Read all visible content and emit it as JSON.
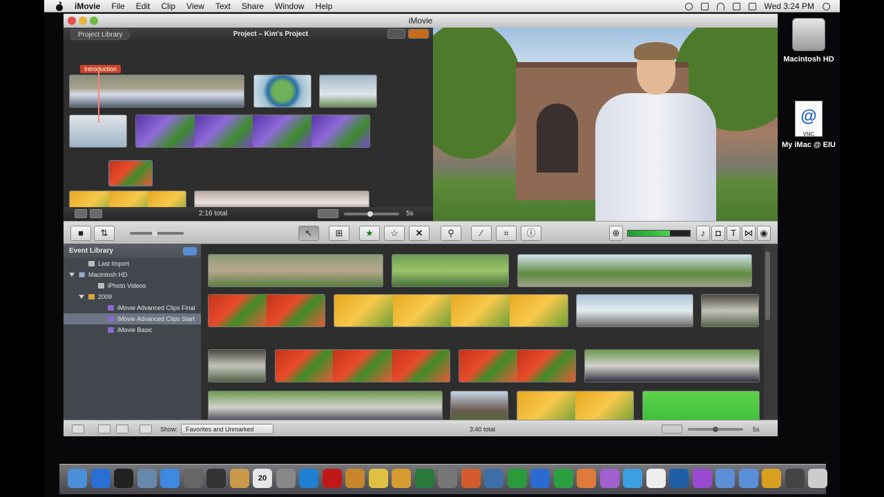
{
  "menubar": {
    "app": "iMovie",
    "items": [
      "File",
      "Edit",
      "Clip",
      "View",
      "Text",
      "Share",
      "Window",
      "Help"
    ],
    "clock": "Wed 3:24 PM"
  },
  "desktop": [
    {
      "label": "Macintosh HD",
      "icon": "hard-drive-icon"
    },
    {
      "label": "My iMac @ EIU",
      "icon": "vnc-document-icon",
      "glyph": "@",
      "sub": "VNC"
    }
  ],
  "window": {
    "title": "iMovie"
  },
  "project": {
    "library_button": "Project Library",
    "title": "Project – Kim's Project",
    "title_tag": "Introduction",
    "total": "2:16 total",
    "zoom_label": "5s"
  },
  "toolbar": {
    "tools": [
      "camera-import",
      "theme",
      "arrow-select",
      "crop-adjust",
      "favorite",
      "unmark",
      "reject",
      "keyword",
      "dropper",
      "crop",
      "info"
    ],
    "audio_level": 0.68,
    "right_tools": [
      "music",
      "photo",
      "title",
      "transition",
      "map"
    ]
  },
  "event_library": {
    "title": "Event Library",
    "items": [
      {
        "label": "Last Import",
        "icon": "cam",
        "indent": 1
      },
      {
        "label": "Macintosh HD",
        "icon": "hd",
        "indent": 0,
        "triangle": true
      },
      {
        "label": "iPhoto Videos",
        "icon": "cam",
        "indent": 2
      },
      {
        "label": "2009",
        "icon": "fold",
        "indent": 1,
        "triangle": true
      },
      {
        "label": "iMovie Advanced Clips Final",
        "icon": "star",
        "indent": 3
      },
      {
        "label": "iMovie Advanced Clips Start",
        "icon": "star",
        "indent": 3,
        "selected": true
      },
      {
        "label": "iMovie Basic",
        "icon": "star",
        "indent": 3
      }
    ]
  },
  "browser": {
    "show_label": "Show:",
    "filter": "Favorites and Unmarked",
    "total": "3:40 total",
    "zoom_label": "5s"
  },
  "dock": [
    {
      "name": "finder",
      "color": "#4a8fd8"
    },
    {
      "name": "app-store",
      "color": "#2a6fd6"
    },
    {
      "name": "dashboard",
      "color": "#222"
    },
    {
      "name": "system-prefs-wrench",
      "color": "#6688aa"
    },
    {
      "name": "safari",
      "color": "#3d8ae0"
    },
    {
      "name": "mail",
      "color": "#666"
    },
    {
      "name": "facetime",
      "color": "#333"
    },
    {
      "name": "address-book",
      "color": "#c99a4a"
    },
    {
      "name": "ical",
      "color": "#e6e6e6",
      "glyph": "20"
    },
    {
      "name": "preview",
      "color": "#888"
    },
    {
      "name": "itunes",
      "color": "#1f7fd0"
    },
    {
      "name": "photo-booth",
      "color": "#c01818"
    },
    {
      "name": "iphoto",
      "color": "#c8862a"
    },
    {
      "name": "imovie",
      "color": "#e0c040"
    },
    {
      "name": "garageband",
      "color": "#d59a30"
    },
    {
      "name": "time-machine",
      "color": "#287a3a"
    },
    {
      "name": "system-preferences",
      "color": "#777"
    },
    {
      "name": "keynote",
      "color": "#d35b2b"
    },
    {
      "name": "xcode",
      "color": "#3e6ea8"
    },
    {
      "name": "numbers",
      "color": "#2a9a3a"
    },
    {
      "name": "word",
      "color": "#2b6bd0"
    },
    {
      "name": "excel",
      "color": "#2aa040"
    },
    {
      "name": "powerpoint",
      "color": "#e07a3a"
    },
    {
      "name": "entourage",
      "color": "#a060d0"
    },
    {
      "name": "messenger",
      "color": "#3aa0e0"
    },
    {
      "name": "grid",
      "color": "#eee"
    },
    {
      "name": "quicktime",
      "color": "#1e5fa8"
    },
    {
      "name": "podcast",
      "color": "#9a4ad0"
    },
    {
      "name": "downloads",
      "color": "#5a8fd8"
    },
    {
      "name": "documents",
      "color": "#5a8fd8"
    },
    {
      "name": "stack",
      "color": "#d9a020"
    },
    {
      "name": "console",
      "color": "#444"
    },
    {
      "name": "trash",
      "color": "#ccc"
    }
  ]
}
